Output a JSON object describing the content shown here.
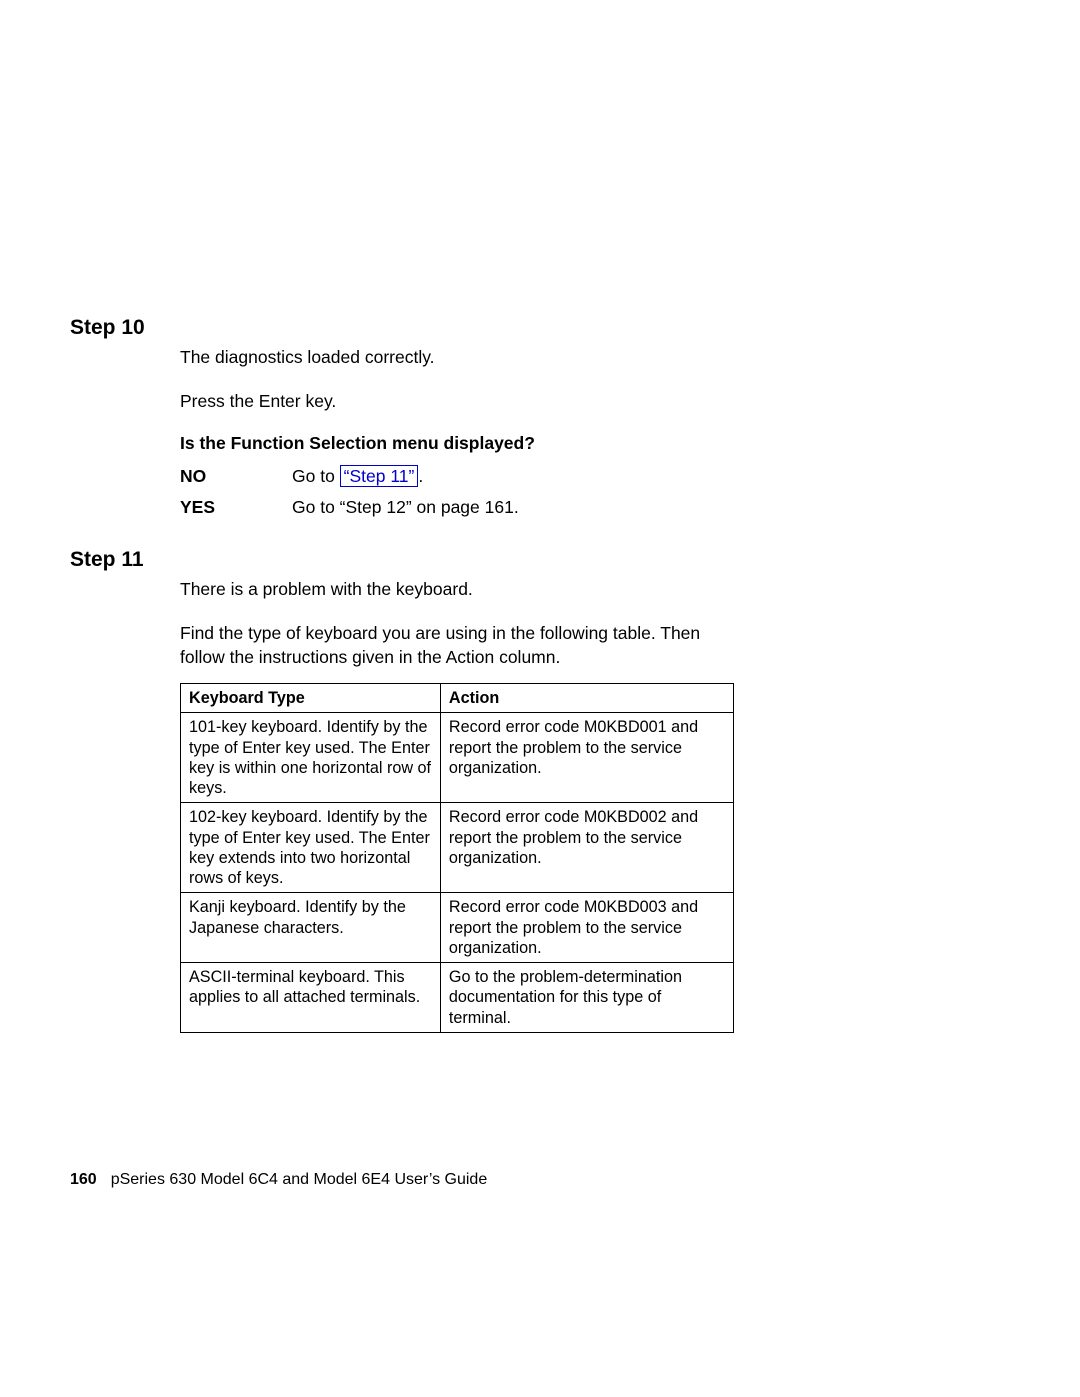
{
  "step10": {
    "heading": "Step 10",
    "line1": "The diagnostics loaded correctly.",
    "line2": "Press the Enter key.",
    "question": "Is the Function Selection menu displayed?",
    "no_label": "NO",
    "no_prefix": "Go to ",
    "no_link": "“Step 11”",
    "no_suffix": ".",
    "yes_label": "YES",
    "yes_text": "Go to “Step 12” on page 161."
  },
  "step11": {
    "heading": "Step 11",
    "line1": "There is a problem with the keyboard.",
    "line2": "Find the type of keyboard you are using in the following table. Then follow the instructions given in the Action column.",
    "table": {
      "head": {
        "c1": "Keyboard Type",
        "c2": "Action"
      },
      "rows": [
        {
          "c1": "101-key keyboard. Identify by the type of Enter key used. The Enter key is within one horizontal row of keys.",
          "c2": "Record error code M0KBD001 and report the problem to the service organization."
        },
        {
          "c1": "102-key keyboard. Identify by the type of Enter key used. The Enter key extends into two horizontal rows of keys.",
          "c2": "Record error code M0KBD002 and report the problem to the service organization."
        },
        {
          "c1": "Kanji keyboard. Identify by the Japanese characters.",
          "c2": "Record error code M0KBD003 and report the problem to the service organization."
        },
        {
          "c1": "ASCII-terminal keyboard. This applies to all attached terminals.",
          "c2": "Go to the problem-determination documentation for this type of terminal."
        }
      ]
    }
  },
  "footer": {
    "page_number": "160",
    "title": "pSeries 630 Model 6C4 and Model 6E4 User’s Guide"
  }
}
